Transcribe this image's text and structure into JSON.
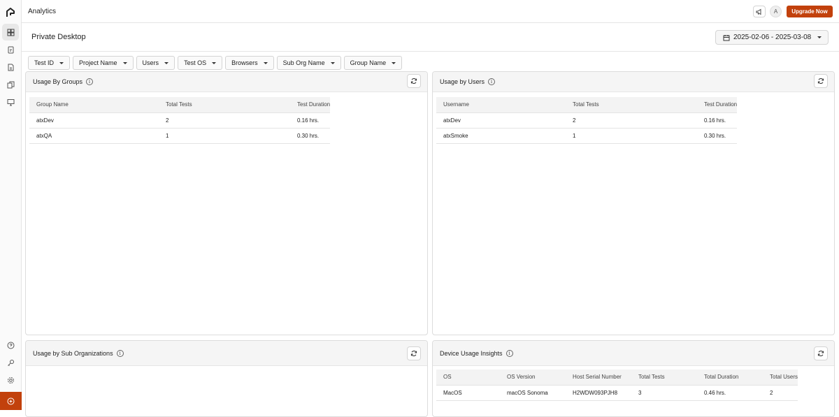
{
  "app": {
    "title": "Analytics"
  },
  "topbar": {
    "avatar_initial": "A",
    "upgrade_label": "Upgrade Now"
  },
  "page": {
    "title": "Private Desktop",
    "date_range": "2025-02-06 - 2025-03-08"
  },
  "filters": [
    "Test ID",
    "Project Name",
    "Users",
    "Test OS",
    "Browsers",
    "Sub Org Name",
    "Group Name"
  ],
  "groups_panel": {
    "title": "Usage By Groups",
    "columns": [
      "Group Name",
      "Total Tests",
      "Test Duration"
    ],
    "rows": [
      [
        "atxDev",
        "2",
        "0.16 hrs."
      ],
      [
        "atxQA",
        "1",
        "0.30 hrs."
      ]
    ]
  },
  "users_panel": {
    "title": "Usage by Users",
    "columns": [
      "Username",
      "Total Tests",
      "Test Duration"
    ],
    "rows": [
      [
        "atxDev",
        "2",
        "0.16 hrs."
      ],
      [
        "atxSmoke",
        "1",
        "0.30 hrs."
      ]
    ]
  },
  "suborg_panel": {
    "title": "Usage by Sub Organizations"
  },
  "device_panel": {
    "title": "Device Usage Insights",
    "columns": [
      "OS",
      "OS Version",
      "Host Serial Number",
      "Total Tests",
      "Total Duration",
      "Total Users"
    ],
    "rows": [
      [
        "MacOS",
        "macOS Sonoma",
        "H2WDW093PJH8",
        "3",
        "0.46 hrs.",
        "2"
      ]
    ]
  },
  "icons": {
    "rail": [
      "logo-icon",
      "dashboard-icon",
      "tests-icon",
      "document-icon",
      "copy-icon",
      "desktop-icon",
      "help-icon",
      "key-icon",
      "settings-icon",
      "plus-circle-icon"
    ],
    "accent": "#c2410c"
  }
}
